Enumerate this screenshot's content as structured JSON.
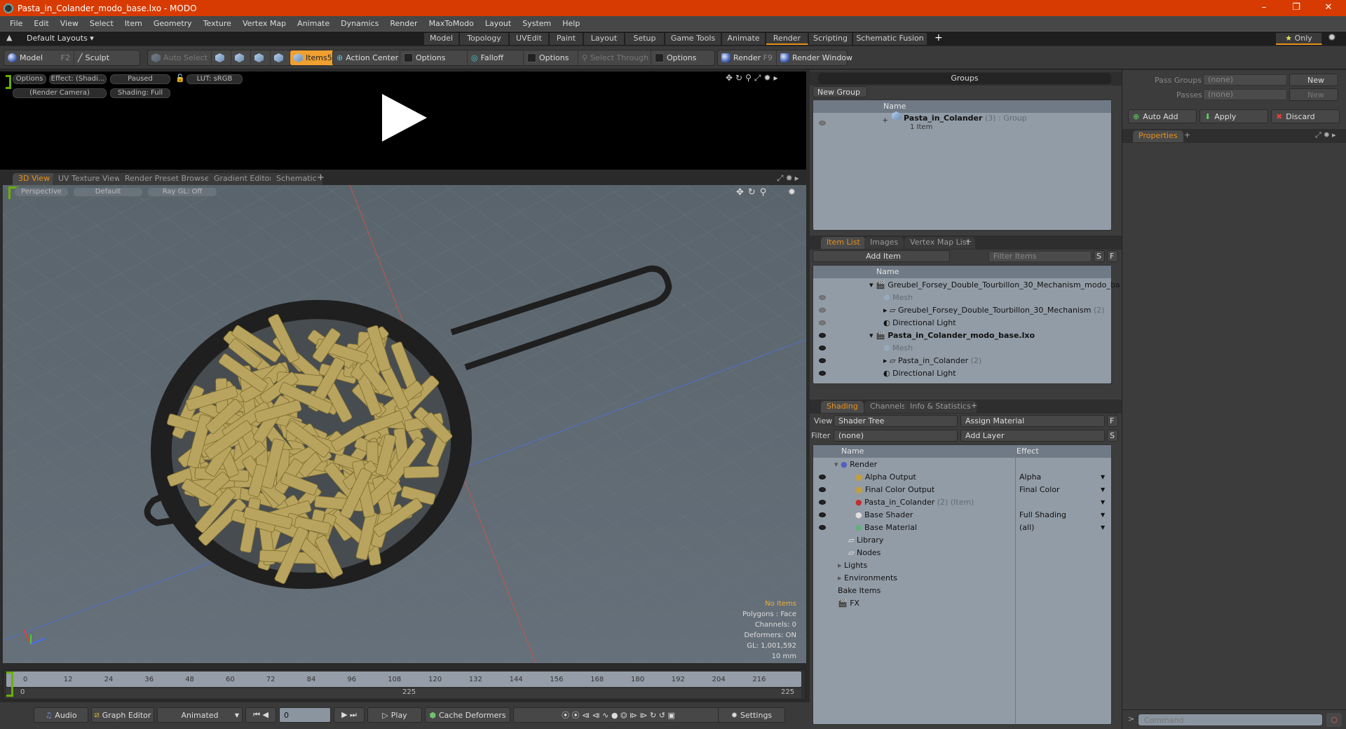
{
  "window": {
    "title": "Pasta_in_Colander_modo_base.lxo - MODO",
    "minimize": "–",
    "maximize": "❐",
    "close": "✕"
  },
  "menu": [
    "File",
    "Edit",
    "View",
    "Select",
    "Item",
    "Geometry",
    "Texture",
    "Vertex Map",
    "Animate",
    "Dynamics",
    "Render",
    "MaxToModo",
    "Layout",
    "System",
    "Help"
  ],
  "layouts": {
    "label": "Default Layouts ▾",
    "tabs": [
      "Model",
      "Topology",
      "UVEdit",
      "Paint",
      "Layout",
      "Setup",
      "Game Tools",
      "Animate",
      "Render",
      "Scripting",
      "Schematic Fusion"
    ],
    "active_tab": "Render",
    "add": "+",
    "only": "Only"
  },
  "toolbar": {
    "model": "Model",
    "model_key": "F2",
    "sculpt": "Sculpt",
    "auto_select": "Auto Select",
    "items": "Items",
    "items_key": "5",
    "action_center": "Action Center",
    "options1": "Options",
    "falloff": "Falloff",
    "options2": "Options",
    "select_through": "Select Through",
    "options3": "Options",
    "render": "Render",
    "render_key": "F9",
    "render_window": "Render Window"
  },
  "render_view": {
    "options": "Options",
    "effect": "Effect: (Shadi...",
    "paused": "Paused",
    "lut": "LUT: sRGB",
    "camera": "(Render Camera)",
    "shading": "Shading: Full"
  },
  "view_tabs": [
    "3D View",
    "UV Texture View",
    "Render Preset Browser",
    "Gradient Editor",
    "Schematic"
  ],
  "viewport": {
    "perspective": "Perspective",
    "default": "Default",
    "raygl": "Ray GL: Off",
    "status": {
      "no_items": "No Items",
      "polygons": "Polygons : Face",
      "channels": "Channels: 0",
      "deformers": "Deformers: ON",
      "gl": "GL: 1,001,592",
      "scale": "10 mm"
    },
    "colors": {
      "pasta": "#b8a45e",
      "colander": "#1f1f1f",
      "grid_bg": "#5e6870"
    }
  },
  "timeline": {
    "ticks": [
      "0",
      "12",
      "24",
      "36",
      "48",
      "60",
      "72",
      "84",
      "96",
      "108",
      "120",
      "132",
      "144",
      "156",
      "168",
      "180",
      "192",
      "204",
      "216"
    ],
    "range_start": "0",
    "range_mid": "225",
    "range_end": "225"
  },
  "transport": {
    "audio": "Audio",
    "graph_editor": "Graph Editor",
    "mode": "Animated",
    "frame": "0",
    "play": "Play",
    "cache": "Cache Deformers",
    "settings": "Settings"
  },
  "groups": {
    "title": "Groups",
    "new_group": "New Group",
    "col_name": "Name",
    "rows": [
      {
        "name": "Pasta_in_Colander",
        "count": "(3)",
        "type": ": Group",
        "sub": "1 Item"
      }
    ]
  },
  "item_list": {
    "tabs": [
      "Item List",
      "Images",
      "Vertex Map List"
    ],
    "add_item": "Add Item",
    "filter": "Filter Items",
    "s": "S",
    "f": "F",
    "col_name": "Name",
    "rows": [
      {
        "name": "Greubel_Forsey_Double_Tourbillon_30_Mechanism_modo_ba ...",
        "bold": false,
        "indent": 0,
        "count": ""
      },
      {
        "name": "Mesh",
        "indent": 1,
        "count": ""
      },
      {
        "name": "Greubel_Forsey_Double_Tourbillon_30_Mechanism",
        "indent": 1,
        "count": "(2)"
      },
      {
        "name": "Directional Light",
        "indent": 1,
        "count": ""
      },
      {
        "name": "Pasta_in_Colander_modo_base.lxo",
        "bold": true,
        "indent": 0,
        "count": ""
      },
      {
        "name": "Mesh",
        "indent": 1,
        "count": ""
      },
      {
        "name": "Pasta_in_Colander",
        "indent": 1,
        "count": "(2)"
      },
      {
        "name": "Directional Light",
        "indent": 1,
        "count": ""
      }
    ]
  },
  "shading": {
    "tabs": [
      "Shading",
      "Channels",
      "Info & Statistics"
    ],
    "view_label": "View",
    "view_value": "Shader Tree",
    "assign": "Assign Material",
    "f": "F",
    "filter_label": "Filter",
    "filter_value": "(none)",
    "add_layer": "Add Layer",
    "s": "S",
    "col_name": "Name",
    "col_effect": "Effect",
    "rows": [
      {
        "name": "Render",
        "effect": ""
      },
      {
        "name": "Alpha Output",
        "effect": "Alpha"
      },
      {
        "name": "Final Color Output",
        "effect": "Final Color"
      },
      {
        "name": "Pasta_in_Colander",
        "extra": "(2) (Item)",
        "effect": ""
      },
      {
        "name": "Base Shader",
        "effect": "Full Shading"
      },
      {
        "name": "Base Material",
        "effect": "(all)"
      },
      {
        "name": "Library",
        "effect": ""
      },
      {
        "name": "Nodes",
        "effect": ""
      },
      {
        "name": "Lights",
        "effect": ""
      },
      {
        "name": "Environments",
        "effect": ""
      },
      {
        "name": "Bake Items",
        "effect": ""
      },
      {
        "name": "FX",
        "effect": ""
      }
    ]
  },
  "passes": {
    "pass_groups": "Pass Groups",
    "passes": "Passes",
    "none": "(none)",
    "new": "New",
    "auto_add": "Auto Add",
    "apply": "Apply",
    "discard": "Discard",
    "properties": "Properties"
  },
  "command": {
    "placeholder": "Command",
    "prompt": ">"
  }
}
